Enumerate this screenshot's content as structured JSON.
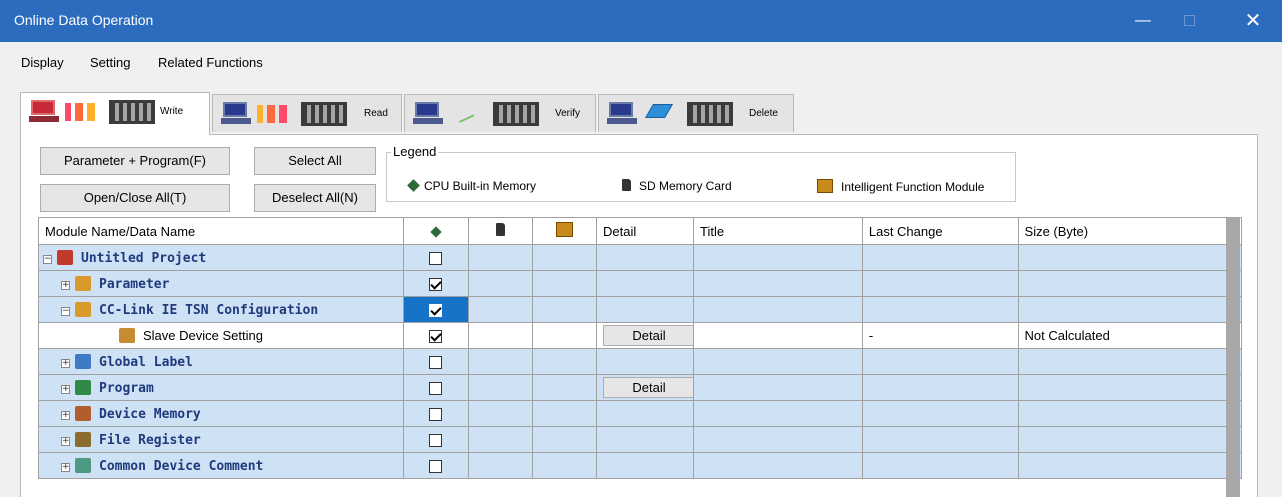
{
  "window": {
    "title": "Online Data Operation",
    "minimize": "—",
    "close": "✕"
  },
  "menu": [
    "Display",
    "Setting",
    "Related Functions"
  ],
  "tabs": [
    {
      "label": "Write",
      "active": true
    },
    {
      "label": "Read",
      "active": false
    },
    {
      "label": "Verify",
      "active": false
    },
    {
      "label": "Delete",
      "active": false
    }
  ],
  "buttons": {
    "param_program": "Parameter + Program(F)",
    "select_all": "Select All",
    "open_close_all": "Open/Close All(T)",
    "deselect_all": "Deselect All(N)"
  },
  "legend": {
    "title": "Legend",
    "cpu": "CPU Built-in Memory",
    "sd": "SD Memory Card",
    "ifm": "Intelligent Function Module"
  },
  "table": {
    "headers": {
      "name": "Module Name/Data Name",
      "detail": "Detail",
      "title": "Title",
      "last_change": "Last Change",
      "size": "Size (Byte)"
    },
    "rows": [
      {
        "name": "Untitled Project",
        "checked": false,
        "detail": "",
        "last_change": "",
        "size": ""
      },
      {
        "name": "Parameter",
        "checked": true,
        "detail": "",
        "last_change": "",
        "size": ""
      },
      {
        "name": "CC-Link IE TSN Configuration",
        "checked": true,
        "detail": "",
        "last_change": "",
        "size": ""
      },
      {
        "name": "Slave Device Setting",
        "checked": true,
        "detail": "Detail",
        "last_change": "-",
        "size": "Not Calculated"
      },
      {
        "name": "Global Label",
        "checked": false,
        "detail": "",
        "last_change": "",
        "size": ""
      },
      {
        "name": "Program",
        "checked": false,
        "detail": "Detail",
        "last_change": "",
        "size": ""
      },
      {
        "name": "Device Memory",
        "checked": false,
        "detail": "",
        "last_change": "",
        "size": ""
      },
      {
        "name": "File Register",
        "checked": false,
        "detail": "",
        "last_change": "",
        "size": ""
      },
      {
        "name": "Common Device Comment",
        "checked": false,
        "detail": "",
        "last_change": "",
        "size": ""
      }
    ]
  },
  "colors": {
    "titlebar": "#2b6cbf",
    "row_highlight": "#cfe1f5",
    "selected_cell": "#1673c8"
  }
}
